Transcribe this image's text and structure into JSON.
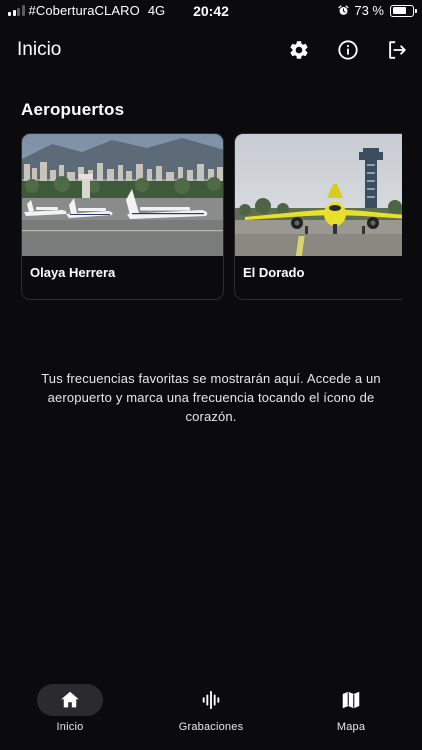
{
  "status_bar": {
    "carrier": "#CoberturaCLARO",
    "network": "4G",
    "time": "20:42",
    "battery_text": "73 %",
    "battery_level": 0.73
  },
  "header": {
    "title": "Inicio"
  },
  "airports": {
    "section_title": "Aeropuertos",
    "items": [
      {
        "name": "Olaya Herrera"
      },
      {
        "name": "El Dorado"
      }
    ]
  },
  "favorites": {
    "empty_message": "Tus frecuencias favoritas se mostrarán aquí. Accede a un aeropuerto y marca una frecuencia tocando el ícono de corazón."
  },
  "tabbar": {
    "items": [
      {
        "label": "Inicio",
        "icon": "home-icon",
        "active": true
      },
      {
        "label": "Grabaciones",
        "icon": "waveform-icon",
        "active": false
      },
      {
        "label": "Mapa",
        "icon": "map-icon",
        "active": false
      }
    ]
  },
  "colors": {
    "background": "#0b0b0d",
    "card_border": "#2c2c30",
    "active_tab": "#2b2b2f",
    "text": "#ffffff",
    "plane_yellow": "#e8e02a"
  }
}
